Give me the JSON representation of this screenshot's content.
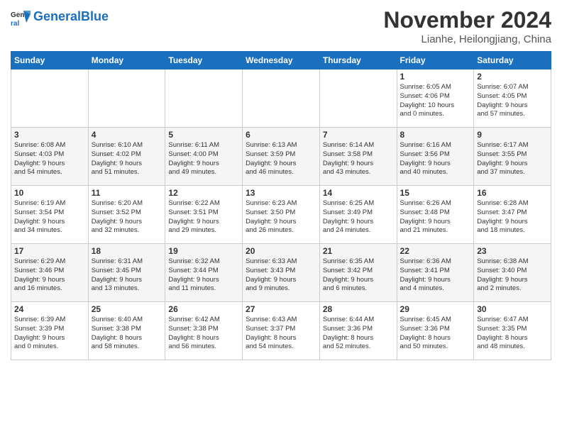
{
  "logo": {
    "line1": "General",
    "line2": "Blue"
  },
  "title": "November 2024",
  "location": "Lianhe, Heilongjiang, China",
  "days_of_week": [
    "Sunday",
    "Monday",
    "Tuesday",
    "Wednesday",
    "Thursday",
    "Friday",
    "Saturday"
  ],
  "weeks": [
    [
      {
        "day": "",
        "info": ""
      },
      {
        "day": "",
        "info": ""
      },
      {
        "day": "",
        "info": ""
      },
      {
        "day": "",
        "info": ""
      },
      {
        "day": "",
        "info": ""
      },
      {
        "day": "1",
        "info": "Sunrise: 6:05 AM\nSunset: 4:06 PM\nDaylight: 10 hours\nand 0 minutes."
      },
      {
        "day": "2",
        "info": "Sunrise: 6:07 AM\nSunset: 4:05 PM\nDaylight: 9 hours\nand 57 minutes."
      }
    ],
    [
      {
        "day": "3",
        "info": "Sunrise: 6:08 AM\nSunset: 4:03 PM\nDaylight: 9 hours\nand 54 minutes."
      },
      {
        "day": "4",
        "info": "Sunrise: 6:10 AM\nSunset: 4:02 PM\nDaylight: 9 hours\nand 51 minutes."
      },
      {
        "day": "5",
        "info": "Sunrise: 6:11 AM\nSunset: 4:00 PM\nDaylight: 9 hours\nand 49 minutes."
      },
      {
        "day": "6",
        "info": "Sunrise: 6:13 AM\nSunset: 3:59 PM\nDaylight: 9 hours\nand 46 minutes."
      },
      {
        "day": "7",
        "info": "Sunrise: 6:14 AM\nSunset: 3:58 PM\nDaylight: 9 hours\nand 43 minutes."
      },
      {
        "day": "8",
        "info": "Sunrise: 6:16 AM\nSunset: 3:56 PM\nDaylight: 9 hours\nand 40 minutes."
      },
      {
        "day": "9",
        "info": "Sunrise: 6:17 AM\nSunset: 3:55 PM\nDaylight: 9 hours\nand 37 minutes."
      }
    ],
    [
      {
        "day": "10",
        "info": "Sunrise: 6:19 AM\nSunset: 3:54 PM\nDaylight: 9 hours\nand 34 minutes."
      },
      {
        "day": "11",
        "info": "Sunrise: 6:20 AM\nSunset: 3:52 PM\nDaylight: 9 hours\nand 32 minutes."
      },
      {
        "day": "12",
        "info": "Sunrise: 6:22 AM\nSunset: 3:51 PM\nDaylight: 9 hours\nand 29 minutes."
      },
      {
        "day": "13",
        "info": "Sunrise: 6:23 AM\nSunset: 3:50 PM\nDaylight: 9 hours\nand 26 minutes."
      },
      {
        "day": "14",
        "info": "Sunrise: 6:25 AM\nSunset: 3:49 PM\nDaylight: 9 hours\nand 24 minutes."
      },
      {
        "day": "15",
        "info": "Sunrise: 6:26 AM\nSunset: 3:48 PM\nDaylight: 9 hours\nand 21 minutes."
      },
      {
        "day": "16",
        "info": "Sunrise: 6:28 AM\nSunset: 3:47 PM\nDaylight: 9 hours\nand 18 minutes."
      }
    ],
    [
      {
        "day": "17",
        "info": "Sunrise: 6:29 AM\nSunset: 3:46 PM\nDaylight: 9 hours\nand 16 minutes."
      },
      {
        "day": "18",
        "info": "Sunrise: 6:31 AM\nSunset: 3:45 PM\nDaylight: 9 hours\nand 13 minutes."
      },
      {
        "day": "19",
        "info": "Sunrise: 6:32 AM\nSunset: 3:44 PM\nDaylight: 9 hours\nand 11 minutes."
      },
      {
        "day": "20",
        "info": "Sunrise: 6:33 AM\nSunset: 3:43 PM\nDaylight: 9 hours\nand 9 minutes."
      },
      {
        "day": "21",
        "info": "Sunrise: 6:35 AM\nSunset: 3:42 PM\nDaylight: 9 hours\nand 6 minutes."
      },
      {
        "day": "22",
        "info": "Sunrise: 6:36 AM\nSunset: 3:41 PM\nDaylight: 9 hours\nand 4 minutes."
      },
      {
        "day": "23",
        "info": "Sunrise: 6:38 AM\nSunset: 3:40 PM\nDaylight: 9 hours\nand 2 minutes."
      }
    ],
    [
      {
        "day": "24",
        "info": "Sunrise: 6:39 AM\nSunset: 3:39 PM\nDaylight: 9 hours\nand 0 minutes."
      },
      {
        "day": "25",
        "info": "Sunrise: 6:40 AM\nSunset: 3:38 PM\nDaylight: 8 hours\nand 58 minutes."
      },
      {
        "day": "26",
        "info": "Sunrise: 6:42 AM\nSunset: 3:38 PM\nDaylight: 8 hours\nand 56 minutes."
      },
      {
        "day": "27",
        "info": "Sunrise: 6:43 AM\nSunset: 3:37 PM\nDaylight: 8 hours\nand 54 minutes."
      },
      {
        "day": "28",
        "info": "Sunrise: 6:44 AM\nSunset: 3:36 PM\nDaylight: 8 hours\nand 52 minutes."
      },
      {
        "day": "29",
        "info": "Sunrise: 6:45 AM\nSunset: 3:36 PM\nDaylight: 8 hours\nand 50 minutes."
      },
      {
        "day": "30",
        "info": "Sunrise: 6:47 AM\nSunset: 3:35 PM\nDaylight: 8 hours\nand 48 minutes."
      }
    ]
  ]
}
